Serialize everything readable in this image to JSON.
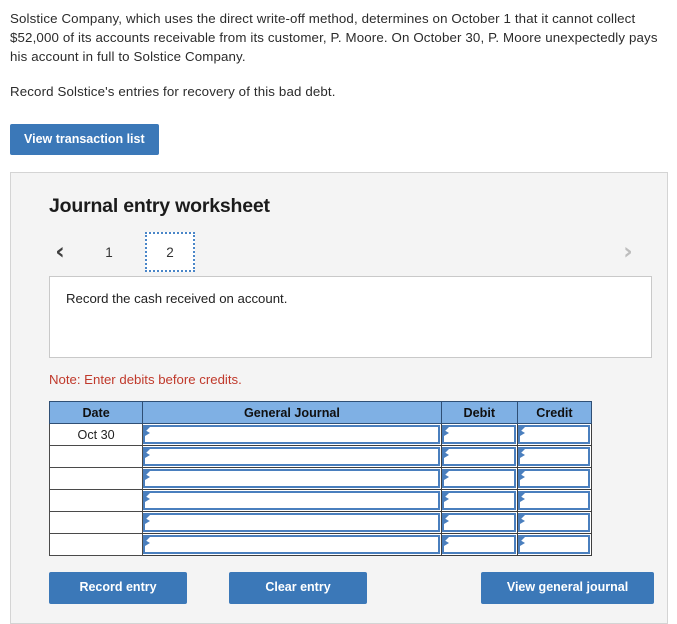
{
  "problem": {
    "paragraph1": "Solstice Company, which uses the direct write-off method, determines on October 1 that it cannot collect $52,000 of its accounts receivable from its customer, P. Moore. On October 30, P. Moore unexpectedly pays his account in full to Solstice Company.",
    "paragraph2": "Record Solstice's entries for recovery of this bad debt."
  },
  "toolbar": {
    "view_transaction_list_label": "View transaction list"
  },
  "worksheet": {
    "title": "Journal entry worksheet",
    "prev_arrow": "‹",
    "next_arrow": "›",
    "tabs": [
      {
        "label": "1",
        "active": false
      },
      {
        "label": "2",
        "active": true
      }
    ],
    "description": "Record the cash received on account.",
    "note": "Note: Enter debits before credits."
  },
  "table": {
    "headers": [
      "Date",
      "General Journal",
      "Debit",
      "Credit"
    ],
    "rows": [
      {
        "date": "Oct 30",
        "general_journal": "",
        "debit": "",
        "credit": ""
      },
      {
        "date": "",
        "general_journal": "",
        "debit": "",
        "credit": ""
      },
      {
        "date": "",
        "general_journal": "",
        "debit": "",
        "credit": ""
      },
      {
        "date": "",
        "general_journal": "",
        "debit": "",
        "credit": ""
      },
      {
        "date": "",
        "general_journal": "",
        "debit": "",
        "credit": ""
      },
      {
        "date": "",
        "general_journal": "",
        "debit": "",
        "credit": ""
      }
    ]
  },
  "footer": {
    "record_entry_label": "Record entry",
    "clear_entry_label": "Clear entry",
    "view_general_journal_label": "View general journal"
  },
  "colors": {
    "button_blue": "#3b78b8",
    "table_header_blue": "#7fb0e4",
    "input_border_blue": "#4a7fbe",
    "note_red": "#c0392b",
    "panel_bg": "#f4f4f4"
  }
}
